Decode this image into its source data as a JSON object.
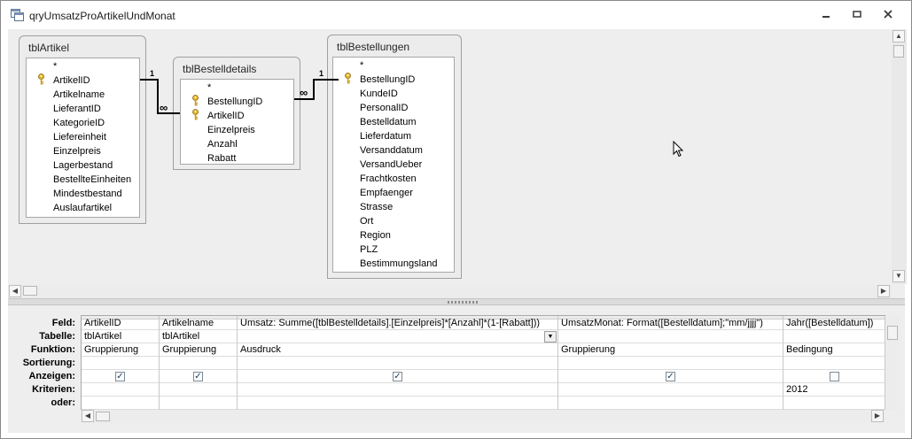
{
  "window": {
    "title": "qryUmsatzProArtikelUndMonat",
    "minimize_icon": "minimize-icon",
    "restore_icon": "restore-icon",
    "close_icon": "close-icon"
  },
  "tables": {
    "tblArtikel": {
      "name": "tblArtikel",
      "fields": [
        "*",
        "ArtikelID",
        "Artikelname",
        "LieferantID",
        "KategorieID",
        "Liefereinheit",
        "Einzelpreis",
        "Lagerbestand",
        "BestellteEinheiten",
        "Mindestbestand",
        "Auslaufartikel"
      ]
    },
    "tblBestelldetails": {
      "name": "tblBestelldetails",
      "fields": [
        "*",
        "BestellungID",
        "ArtikelID",
        "Einzelpreis",
        "Anzahl",
        "Rabatt"
      ]
    },
    "tblBestellungen": {
      "name": "tblBestellungen",
      "fields": [
        "*",
        "BestellungID",
        "KundeID",
        "PersonalID",
        "Bestelldatum",
        "Lieferdatum",
        "Versanddatum",
        "VersandUeber",
        "Frachtkosten",
        "Empfaenger",
        "Strasse",
        "Ort",
        "Region",
        "PLZ",
        "Bestimmungsland"
      ]
    }
  },
  "relations": {
    "one": "1",
    "many": "∞"
  },
  "grid": {
    "row_labels": [
      "Feld:",
      "Tabelle:",
      "Funktion:",
      "Sortierung:",
      "Anzeigen:",
      "Kriterien:",
      "oder:"
    ],
    "columns": [
      {
        "feld": "ArtikelID",
        "tabelle": "tblArtikel",
        "funktion": "Gruppierung",
        "sortierung": "",
        "anzeigen": true,
        "kriterien": "",
        "oder": ""
      },
      {
        "feld": "Artikelname",
        "tabelle": "tblArtikel",
        "funktion": "Gruppierung",
        "sortierung": "",
        "anzeigen": true,
        "kriterien": "",
        "oder": ""
      },
      {
        "feld": "Umsatz: Summe([tblBestelldetails].[Einzelpreis]*[Anzahl]*(1-[Rabatt]))",
        "tabelle": "",
        "funktion": "Ausdruck",
        "sortierung": "",
        "anzeigen": true,
        "kriterien": "",
        "oder": ""
      },
      {
        "feld": "UmsatzMonat: Format([Bestelldatum];\"mm/jjjj\")",
        "tabelle": "",
        "funktion": "Gruppierung",
        "sortierung": "",
        "anzeigen": true,
        "kriterien": "",
        "oder": ""
      },
      {
        "feld": "Jahr([Bestelldatum])",
        "tabelle": "",
        "funktion": "Bedingung",
        "sortierung": "",
        "anzeigen": false,
        "kriterien": "2012",
        "oder": ""
      }
    ]
  }
}
